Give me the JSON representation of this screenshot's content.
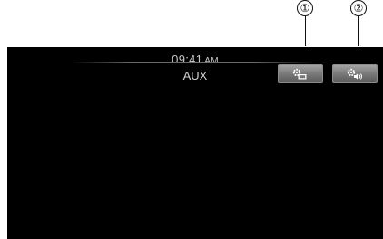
{
  "callouts": [
    "①",
    "②"
  ],
  "status": {
    "time": "09:41",
    "ampm": "AM"
  },
  "source": "AUX",
  "buttons": [
    {
      "icon": "gear-display-icon"
    },
    {
      "icon": "gear-speaker-icon"
    }
  ]
}
